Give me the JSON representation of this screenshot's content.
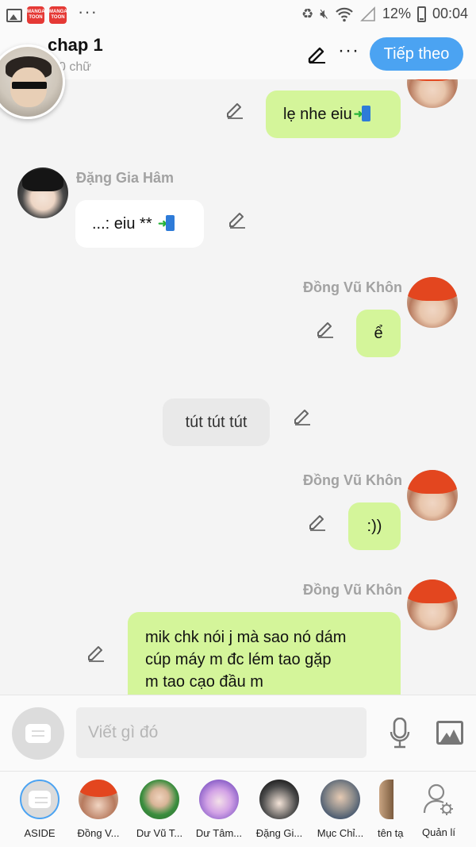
{
  "status_bar": {
    "manga_badge": "MANGA TOON",
    "more": "···",
    "battery": "12%",
    "time": "00:04"
  },
  "header": {
    "title": "chap 1",
    "subtitle": "0 chữ",
    "more": "···",
    "next_button": "Tiếp theo"
  },
  "messages": [
    {
      "text": "lẹ nhe eiu",
      "emoji": "arrow-phone-icon",
      "style": "green"
    },
    {
      "sender": "Đặng Gia Hâm",
      "text": "...: eiu **",
      "emoji": "arrow-phone-icon",
      "style": "white"
    },
    {
      "sender": "Đồng Vũ Khôn",
      "text": "ể",
      "style": "green"
    },
    {
      "text": "tút tút tút",
      "style": "grey"
    },
    {
      "sender": "Đồng Vũ Khôn",
      "text": ":))",
      "style": "green"
    },
    {
      "sender": "Đồng Vũ Khôn",
      "lines": [
        "mik chk nói j mà sao nó dám",
        "cúp máy m đc lém tao gặp",
        "m tao cạo đầu m"
      ],
      "style": "green"
    }
  ],
  "input": {
    "placeholder": "Viết gì đó"
  },
  "bottom_nav": [
    {
      "label": "ASIDE"
    },
    {
      "label": "Đồng V..."
    },
    {
      "label": "Dư Vũ T..."
    },
    {
      "label": "Dư Tâm..."
    },
    {
      "label": "Đặng Gi..."
    },
    {
      "label": "Mục Chỉ..."
    },
    {
      "label": "tên tạ"
    },
    {
      "label": "Quản lí"
    }
  ],
  "colors": {
    "accent": "#4ba3f2",
    "bubble_green": "#d4f59a",
    "bubble_white": "#ffffff",
    "bubble_grey": "#e9e9e9",
    "background": "#f4f4f4"
  }
}
